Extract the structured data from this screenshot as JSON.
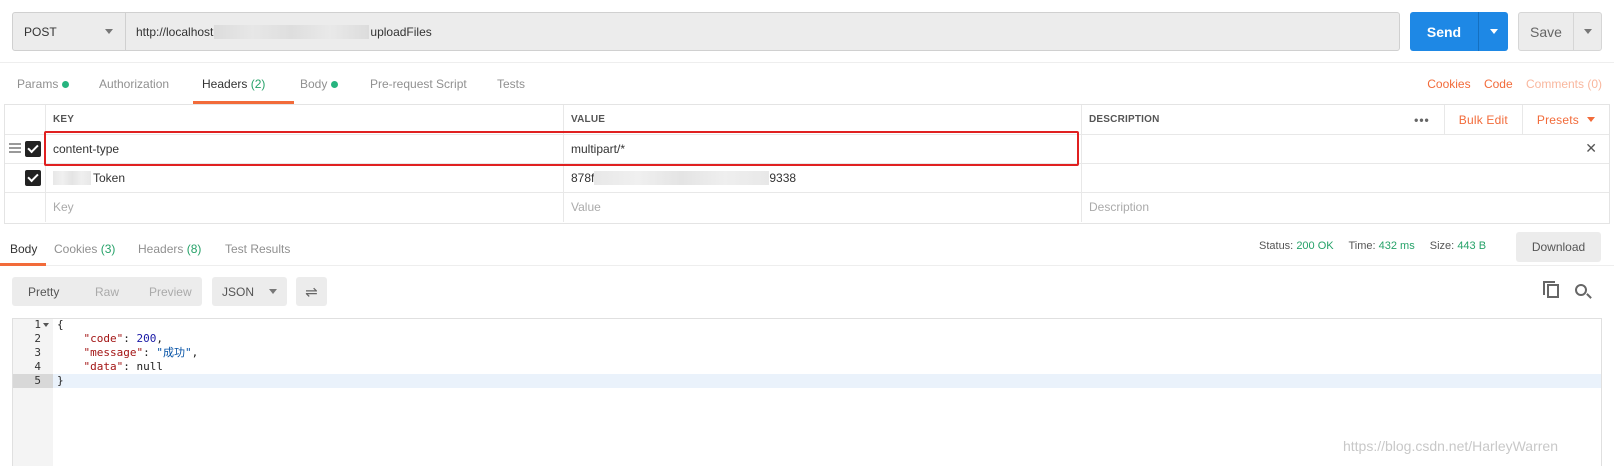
{
  "request": {
    "method": "POST",
    "url_prefix": "http://localhost",
    "url_suffix": "uploadFiles",
    "send_label": "Send",
    "save_label": "Save"
  },
  "request_tabs": [
    {
      "label": "Params"
    },
    {
      "label": "Authorization"
    },
    {
      "label": "Headers",
      "count": "(2)"
    },
    {
      "label": "Body"
    },
    {
      "label": "Pre-request Script"
    },
    {
      "label": "Tests"
    }
  ],
  "right_links": {
    "cookies": "Cookies",
    "code": "Code",
    "comments": "Comments (0)"
  },
  "headers_table": {
    "columns": [
      "KEY",
      "VALUE",
      "DESCRIPTION"
    ],
    "more": "•••",
    "bulk_edit": "Bulk Edit",
    "presets": "Presets",
    "rows": [
      {
        "key": "content-type",
        "value": "multipart/*"
      },
      {
        "key": "Token",
        "value_prefix": "878f",
        "value_suffix": "9338"
      }
    ],
    "placeholders": {
      "key": "Key",
      "value": "Value",
      "description": "Description"
    }
  },
  "response_tabs": [
    {
      "label": "Body"
    },
    {
      "label": "Cookies",
      "count": "(3)"
    },
    {
      "label": "Headers",
      "count": "(8)"
    },
    {
      "label": "Test Results"
    }
  ],
  "response_status": {
    "status_label": "Status:",
    "status": "200 OK",
    "time_label": "Time:",
    "time": "432 ms",
    "size_label": "Size:",
    "size": "443 B",
    "download": "Download"
  },
  "response_toolbar": {
    "formats": [
      "Pretty",
      "Raw",
      "Preview"
    ],
    "language": "JSON"
  },
  "response_body": {
    "line_numbers": [
      "1",
      "2",
      "3",
      "4",
      "5"
    ],
    "open_brace": "{",
    "close_brace": "}",
    "code_key": "\"code\"",
    "code_value": "200",
    "message_key": "\"message\"",
    "message_value": "\"成功\"",
    "data_key": "\"data\"",
    "data_value": "null"
  },
  "watermark": "https://blog.csdn.net/HarleyWarren",
  "colors": {
    "accent": "#f26b3a",
    "send": "#1e88e5",
    "success": "#26a269",
    "highlight": "#e02020"
  }
}
